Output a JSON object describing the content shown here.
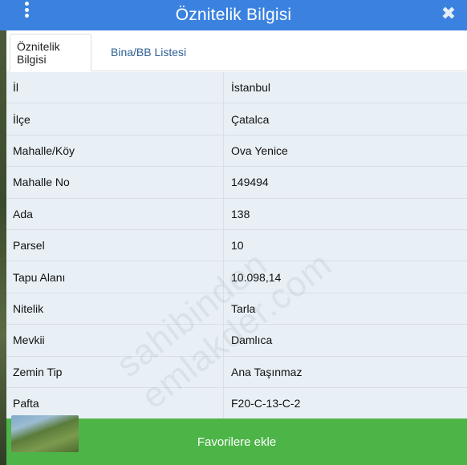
{
  "header": {
    "title": "Öznitelik Bilgisi",
    "menu_icon": "kebab-menu-icon",
    "close_icon": "close-icon",
    "close_glyph": "✖",
    "bg_color": "#3b82e0"
  },
  "tabs": [
    {
      "label": "Öznitelik Bilgisi",
      "active": true
    },
    {
      "label": "Bina/BB Listesi",
      "active": false
    }
  ],
  "attributes": [
    {
      "key": "İl",
      "value": "İstanbul"
    },
    {
      "key": "İlçe",
      "value": "Çatalca"
    },
    {
      "key": "Mahalle/Köy",
      "value": "Ova Yenice"
    },
    {
      "key": "Mahalle No",
      "value": "149494"
    },
    {
      "key": "Ada",
      "value": "138"
    },
    {
      "key": "Parsel",
      "value": "10"
    },
    {
      "key": "Tapu Alanı",
      "value": "10.098,14"
    },
    {
      "key": "Nitelik",
      "value": "Tarla"
    },
    {
      "key": "Mevkii",
      "value": "Damlıca"
    },
    {
      "key": "Zemin Tip",
      "value": "Ana Taşınmaz"
    },
    {
      "key": "Pafta",
      "value": "F20-C-13-C-2"
    }
  ],
  "watermark": "sahibinden emlakder.com",
  "footer": {
    "button_label": "Favorilere ekle",
    "bg_color": "#4db548"
  }
}
